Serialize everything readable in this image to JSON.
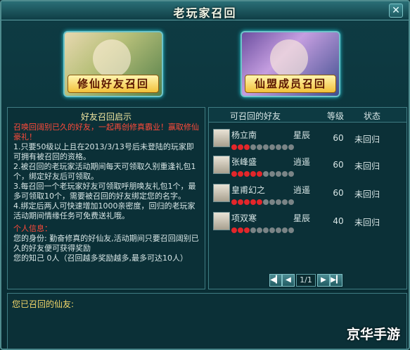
{
  "window": {
    "title": "老玩家召回",
    "close_glyph": "✕"
  },
  "banners": [
    {
      "label": "修仙好友召回"
    },
    {
      "label": "仙盟成员召回"
    }
  ],
  "info_panel": {
    "title": "好友召回启示",
    "intro": "召唤回阔别已久的好友，一起再创修真霸业！赢取修仙豪礼！",
    "rules": [
      "1.只要50级以上且在2013/3/13号后未登陆的玩家即可拥有被召回的资格。",
      "2.被召回的老玩家活动期间每天可领取久别重逢礼包1个，绑定好友后可领取。",
      "3.每召回一个老玩家好友可领取呼朋唤友礼包1个，最多可领取10个，需要被召回的好友绑定您的名字。",
      "4.绑定后两人可快速增加1000亲密度，回归的老玩家活动期间情缘任务可免费送礼哦。"
    ],
    "personal_title": "个人信息：",
    "identity_line": "您的身份: 勤奋修真的好仙友,活动期间只要召回阔别已久的好友便可获得奖励",
    "friend_line": "您的知己  0人（召回越多奖励越多,最多可达10人）"
  },
  "table": {
    "headers": [
      "可召回的好友",
      "等级",
      "状态"
    ],
    "rows": [
      {
        "name": "杨立南",
        "rank": "星辰",
        "level": "60",
        "status": "未回归",
        "hearts": 3
      },
      {
        "name": "张峰盛",
        "rank": "逍遥",
        "level": "60",
        "status": "未回归",
        "hearts": 5
      },
      {
        "name": "皇甫幻之",
        "rank": "逍遥",
        "level": "60",
        "status": "未回归",
        "hearts": 5
      },
      {
        "name": "项双寒",
        "rank": "星辰",
        "level": "40",
        "status": "未回归",
        "hearts": 3
      }
    ],
    "pager": {
      "page": "1/1",
      "first": "◀▎",
      "prev": "◀",
      "next": "▶",
      "last": "▶▎"
    }
  },
  "bottom": {
    "label": "您已召回的仙友:"
  },
  "watermark": "京华手游",
  "colors": {
    "accent_red": "#ff4a3a",
    "accent_yellow": "#f3d76a",
    "heart_on": "#e3262a"
  }
}
